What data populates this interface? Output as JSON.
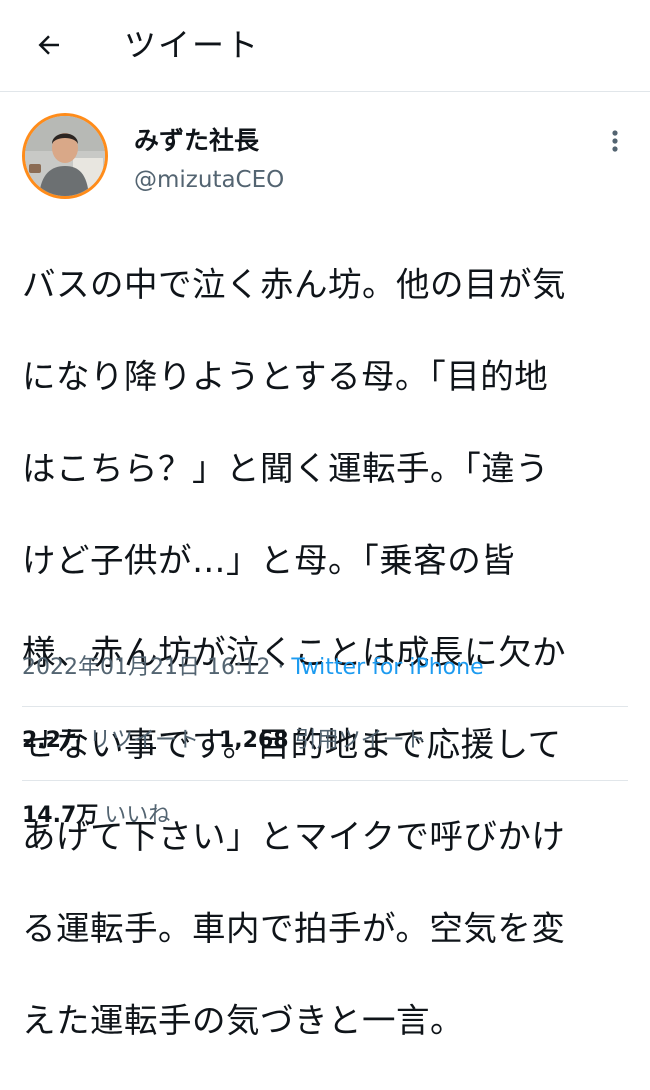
{
  "header": {
    "title": "ツイート",
    "back_icon": "arrow-left-icon"
  },
  "author": {
    "display_name": "みずた社長",
    "handle": "@mizutaCEO",
    "avatar_ring_color": "#ff8c1a"
  },
  "tweet": {
    "text_lines": [
      "バスの中で泣く赤ん坊。他の目が気",
      "になり降りようとする母。「目的地",
      "はこちら？」と聞く運転手。「違う",
      "けど子供が…」と母。「乗客の皆",
      "様、赤ん坊が泣くことは成長に欠か",
      "せない事です。目的地まで応援して",
      "あげて下さい」とマイクで呼びかけ",
      "る運転手。車内で拍手が。空気を変",
      "えた運転手の気づきと一言。"
    ],
    "timestamp": "2022年01月21日 16:12",
    "separator": "·",
    "source": "Twitter for iPhone"
  },
  "stats": {
    "retweets_count": "2.2万",
    "retweets_label": "リツイート",
    "quotes_count": "1,268",
    "quotes_label": "引用ツイート",
    "likes_count": "14.7万",
    "likes_label": "いいね"
  },
  "colors": {
    "link": "#1d9bf0",
    "secondary_text": "#536471",
    "divider": "#e1e6ea"
  }
}
